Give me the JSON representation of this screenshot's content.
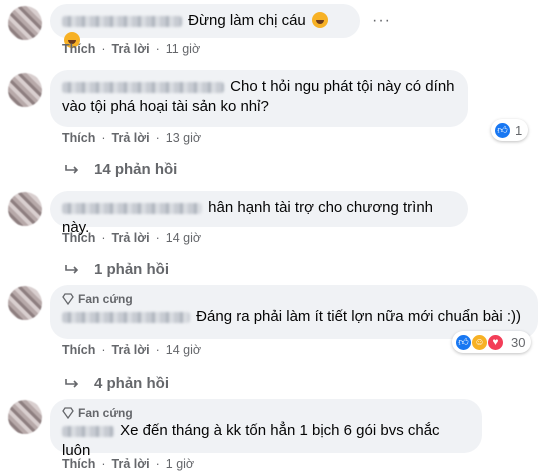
{
  "labels": {
    "like": "Thích",
    "reply": "Trả lời",
    "fan_badge": "Fan cứng"
  },
  "comments": [
    {
      "text": "Đừng làm chị cáu",
      "emoji": [
        "rolling-on-floor-laughing",
        "rolling-on-floor-laughing"
      ],
      "time": "11 giờ"
    },
    {
      "text": "Cho t hỏi ngu phát tội này có dính vào tội phá hoại tài sản ko nhỉ?",
      "time": "13 giờ",
      "reactions": {
        "types": [
          "like"
        ],
        "count": "1"
      },
      "replies": "14 phản hồi"
    },
    {
      "text": "hân hạnh tài trợ cho chương trình này.",
      "time": "14 giờ",
      "replies": "1 phản hồi"
    },
    {
      "text": "Đáng ra phải làm ít tiết lợn nữa mới chuẩn bài :))",
      "time": "14 giờ",
      "reactions": {
        "types": [
          "like",
          "haha",
          "love"
        ],
        "count": "30"
      },
      "replies": "4 phản hồi"
    },
    {
      "text": "Xe đến tháng à kk tốn hẳn 1 bịch 6 gói bvs chắc luôn",
      "time": "1 giờ"
    }
  ],
  "colors": {
    "bubble": "#f0f2f5",
    "muted": "#65676b",
    "like": "#1877f2",
    "haha": "#f7b125",
    "love": "#f33e58"
  }
}
